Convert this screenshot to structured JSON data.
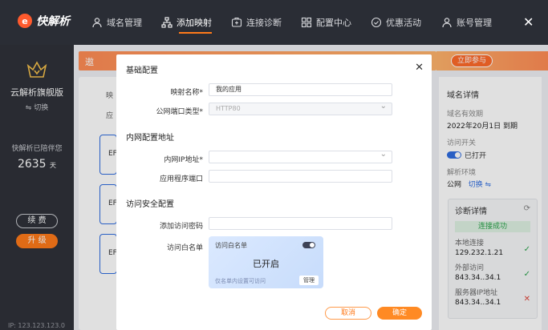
{
  "topbar": {
    "logo": "快解析",
    "nav": [
      {
        "label": "域名管理",
        "icon": "user-icon"
      },
      {
        "label": "添加映射",
        "icon": "network-icon",
        "active": true
      },
      {
        "label": "连接诊断",
        "icon": "diagnose-icon"
      },
      {
        "label": "配置中心",
        "icon": "grid-icon"
      },
      {
        "label": "优惠活动",
        "icon": "gift-icon"
      }
    ],
    "account": "账号管理",
    "close": "✕"
  },
  "sidebar": {
    "plan": "云解析旗舰版",
    "switch": "⇋ 切换",
    "accompany": "快解析已陪伴您",
    "days": "2635",
    "days_unit": "天",
    "renew": "续 费",
    "upgrade": "升 级",
    "ip": "IP: 123.123.123.0"
  },
  "background": {
    "banner_text": "遨",
    "join": "立即参与",
    "left_labels": [
      "映",
      "应"
    ],
    "cards": [
      "EF",
      "EF",
      "EF"
    ]
  },
  "modal": {
    "close": "✕",
    "basic_title": "基础配置",
    "mapping_name_label": "映射名称*",
    "mapping_name_value": "我的应用",
    "port_type_label": "公网端口类型*",
    "port_type_value": "HTTP80",
    "lan_title": "内网配置地址",
    "lan_ip_label": "内网IP地址*",
    "lan_ip_value": "",
    "app_port_label": "应用程序端口",
    "app_port_value": "",
    "security_title": "访问安全配置",
    "password_label": "添加访问密码",
    "password_value": "",
    "whitelist_label": "访问白名单",
    "whitelist_card": {
      "title": "访问白名单",
      "status": "已开启",
      "hint": "仅名单内设置可访问",
      "manage": "管理"
    },
    "cancel": "取消",
    "confirm": "确定"
  },
  "right_panel": {
    "title": "域名详情",
    "validity_label": "域名有效期",
    "validity_value": "2022年20月1日  到期",
    "access_label": "访问开关",
    "access_value": "已打开",
    "env_label": "解析环境",
    "env_value": "公网",
    "env_switch": "切换 ⇋",
    "diag_title": "诊断详情",
    "diag_refresh": "⟳",
    "diag_status": "连接成功",
    "local_label": "本地连接",
    "local_value": "129.232.1.21",
    "external_label": "外部访问",
    "external_value": "843.34..34.1",
    "server_label": "服务器IP地址",
    "server_value": "843.34..34.1",
    "check_ok": "✓",
    "check_bad": "✕"
  }
}
